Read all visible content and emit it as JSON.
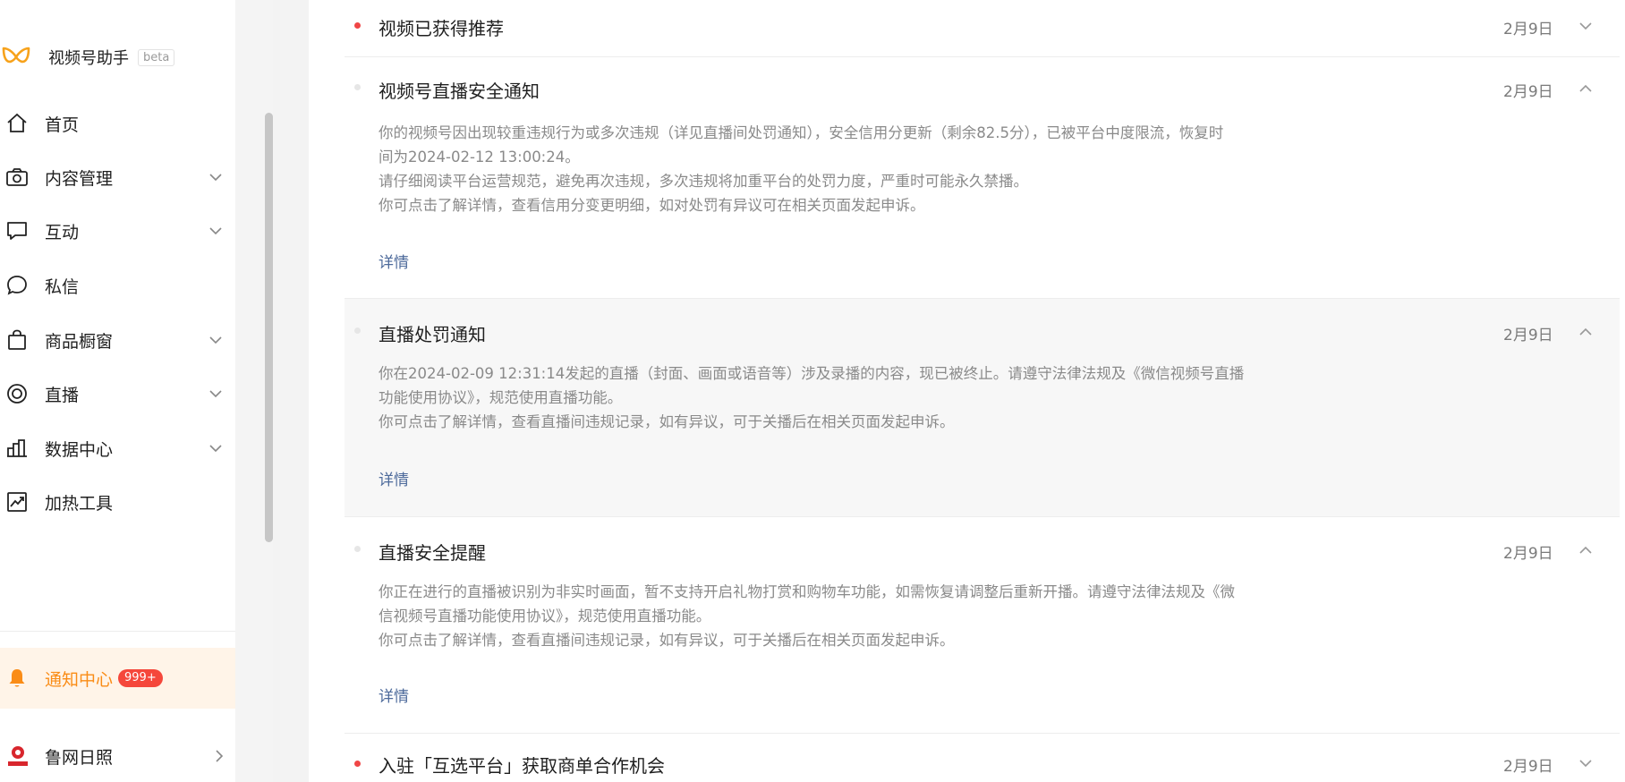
{
  "sidebar": {
    "app_name": "视频号助手",
    "beta": "beta",
    "items": [
      {
        "label": "首页"
      },
      {
        "label": "内容管理"
      },
      {
        "label": "互动"
      },
      {
        "label": "私信"
      },
      {
        "label": "商品橱窗"
      },
      {
        "label": "直播"
      },
      {
        "label": "数据中心"
      },
      {
        "label": "加热工具"
      }
    ],
    "notify": {
      "label": "通知中心",
      "badge": "999+"
    },
    "account": {
      "name": "鲁网日照"
    }
  },
  "messages": [
    {
      "title": "视频已获得推荐",
      "date": "2月9日",
      "unread": true,
      "expanded": false
    },
    {
      "title": "视频号直播安全通知",
      "date": "2月9日",
      "unread": false,
      "expanded": true,
      "lines": [
        "你的视频号因出现较重违规行为或多次违规（详见直播间处罚通知），安全信用分更新（剩余82.5分），已被平台中度限流，恢复时",
        "间为2024-02-12 13:00:24。",
        "请仔细阅读平台运营规范，避免再次违规，多次违规将加重平台的处罚力度，严重时可能永久禁播。",
        "你可点击了解详情，查看信用分变更明细，如对处罚有异议可在相关页面发起申诉。"
      ],
      "detail": "详情"
    },
    {
      "title": "直播处罚通知",
      "date": "2月9日",
      "unread": false,
      "expanded": true,
      "lines": [
        "你在2024-02-09 12:31:14发起的直播（封面、画面或语音等）涉及录播的内容，现已被终止。请遵守法律法规及《微信视频号直播",
        "功能使用协议》，规范使用直播功能。",
        "你可点击了解详情，查看直播间违规记录，如有异议，可于关播后在相关页面发起申诉。"
      ],
      "detail": "详情"
    },
    {
      "title": "直播安全提醒",
      "date": "2月9日",
      "unread": false,
      "expanded": true,
      "lines": [
        "你正在进行的直播被识别为非实时画面，暂不支持开启礼物打赏和购物车功能，如需恢复请调整后重新开播。请遵守法律法规及《微",
        "信视频号直播功能使用协议》，规范使用直播功能。",
        "你可点击了解详情，查看直播间违规记录，如有异议，可于关播后在相关页面发起申诉。"
      ],
      "detail": "详情"
    },
    {
      "title": "入驻「互选平台」获取商单合作机会",
      "date": "2月9日",
      "unread": true,
      "expanded": false
    }
  ],
  "colors": {
    "accent": "#fa8c16",
    "badge": "#f5473b",
    "unread_dot": "#f04646",
    "link": "#4d6a9b"
  }
}
